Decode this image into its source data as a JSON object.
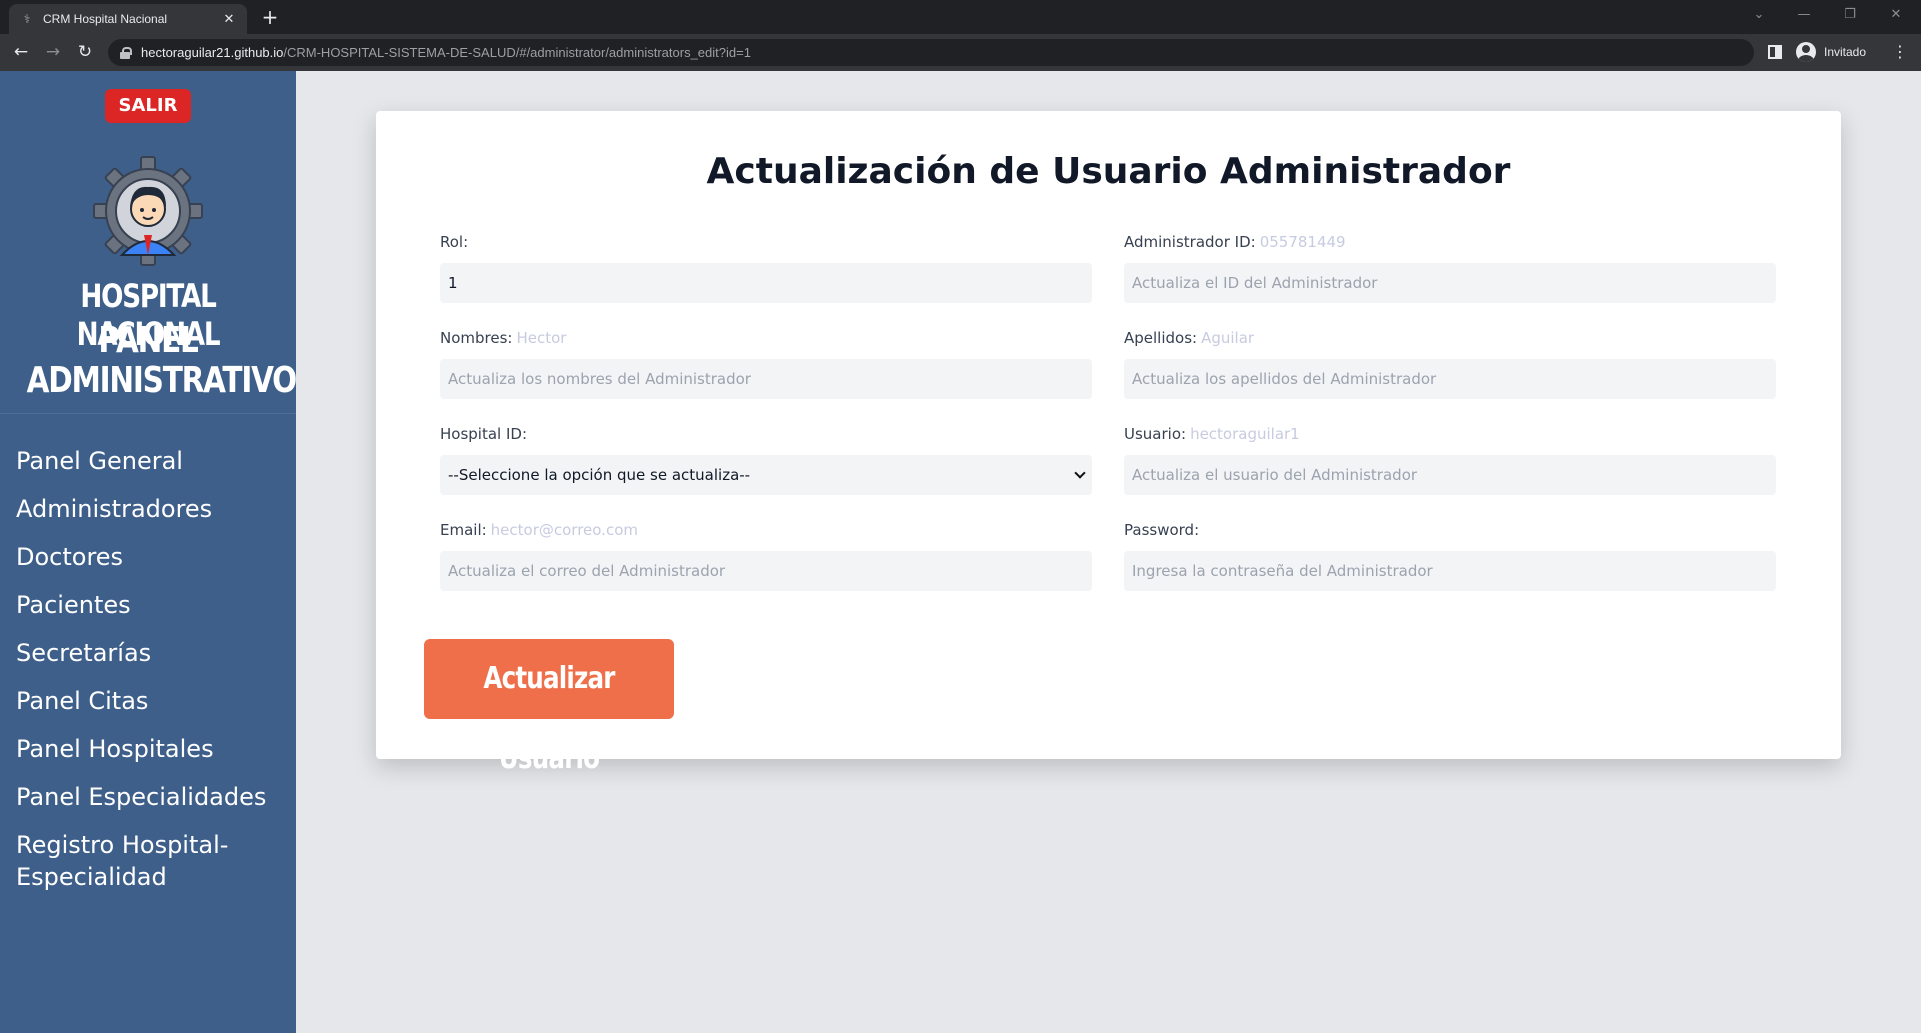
{
  "browser": {
    "tab_title": "CRM Hospital Nacional",
    "url_host": "hectoraguilar21.github.io",
    "url_path": "/CRM-HOSPITAL-SISTEMA-DE-SALUD/#/administrator/administrators_edit?id=1",
    "profile_label": "Invitado"
  },
  "sidebar": {
    "logout_label": "SALIR",
    "brand_line1": "HOSPITAL NACIONAL",
    "brand_line2": "PANEL",
    "brand_line3": "ADMINISTRATIVO",
    "items": [
      {
        "label": "Panel General"
      },
      {
        "label": "Administradores"
      },
      {
        "label": "Doctores"
      },
      {
        "label": "Pacientes"
      },
      {
        "label": "Secretarías"
      },
      {
        "label": "Panel Citas"
      },
      {
        "label": "Panel Hospitales"
      },
      {
        "label": "Panel Especialidades"
      },
      {
        "label": "Registro Hospital-"
      },
      {
        "label": "Especialidad"
      }
    ]
  },
  "form": {
    "title": "Actualización de Usuario Administrador",
    "rol": {
      "label": "Rol:",
      "value": "1"
    },
    "admin_id": {
      "label": "Administrador ID:",
      "current": "055781449",
      "placeholder": "Actualiza el ID del Administrador"
    },
    "nombres": {
      "label": "Nombres:",
      "current": "Hector",
      "placeholder": "Actualiza los nombres del Administrador"
    },
    "apellidos": {
      "label": "Apellidos:",
      "current": "Aguilar",
      "placeholder": "Actualiza los apellidos del Administrador"
    },
    "hospital_id": {
      "label": "Hospital ID:",
      "selected": "--Seleccione la opción que se actualiza--"
    },
    "usuario": {
      "label": "Usuario:",
      "current": "hectoraguilar1",
      "placeholder": "Actualiza el usuario del Administrador"
    },
    "email": {
      "label": "Email:",
      "current": "hector@correo.com",
      "placeholder": "Actualiza el correo del Administrador"
    },
    "password": {
      "label": "Password:",
      "placeholder": "Ingresa la contraseña del Administrador"
    },
    "submit_label": "Actualizar Usuario"
  },
  "colors": {
    "sidebar_bg": "#3e5f8a",
    "logout_bg": "#dc2626",
    "submit_bg": "#ef6f4a",
    "page_bg": "#e5e7eb"
  }
}
